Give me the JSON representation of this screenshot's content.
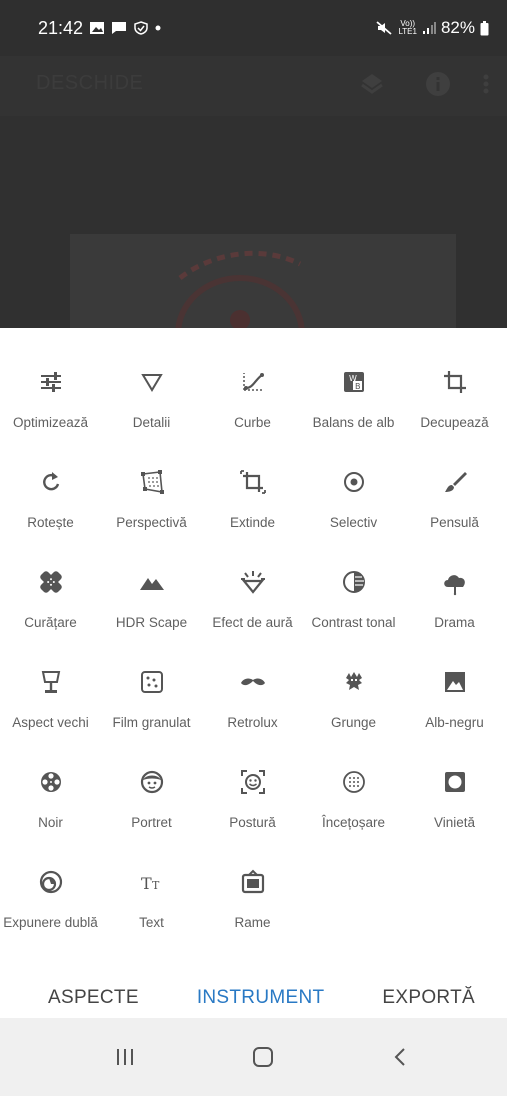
{
  "status_bar": {
    "time": "21:42",
    "battery": "82%",
    "network": "LTE1",
    "volte": "Vo))"
  },
  "app": {
    "title": "DESCHIDE"
  },
  "tools": [
    {
      "label": "Optimizează",
      "icon": "tune-sliders-icon"
    },
    {
      "label": "Detalii",
      "icon": "triangle-down-icon"
    },
    {
      "label": "Curbe",
      "icon": "curves-icon"
    },
    {
      "label": "Balans de alb",
      "icon": "white-balance-icon"
    },
    {
      "label": "Decupează",
      "icon": "crop-icon"
    },
    {
      "label": "Rotește",
      "icon": "rotate-icon"
    },
    {
      "label": "Perspectivă",
      "icon": "perspective-icon"
    },
    {
      "label": "Extinde",
      "icon": "expand-icon"
    },
    {
      "label": "Selectiv",
      "icon": "selective-icon"
    },
    {
      "label": "Pensulă",
      "icon": "brush-icon"
    },
    {
      "label": "Curățare",
      "icon": "healing-icon"
    },
    {
      "label": "HDR Scape",
      "icon": "mountains-icon"
    },
    {
      "label": "Efect de aură",
      "icon": "glamour-glow-icon"
    },
    {
      "label": "Contrast tonal",
      "icon": "tonal-contrast-icon"
    },
    {
      "label": "Drama",
      "icon": "cloud-icon"
    },
    {
      "label": "Aspect vechi",
      "icon": "vintage-lamp-icon"
    },
    {
      "label": "Film granulat",
      "icon": "grainy-film-icon"
    },
    {
      "label": "Retrolux",
      "icon": "mustache-icon"
    },
    {
      "label": "Grunge",
      "icon": "grunge-icon"
    },
    {
      "label": "Alb-negru",
      "icon": "black-white-icon"
    },
    {
      "label": "Noir",
      "icon": "film-reel-icon"
    },
    {
      "label": "Portret",
      "icon": "face-icon"
    },
    {
      "label": "Postură",
      "icon": "face-pose-icon"
    },
    {
      "label": "Încețoșare",
      "icon": "lens-blur-icon"
    },
    {
      "label": "Vinietă",
      "icon": "vignette-icon"
    },
    {
      "label": "Expunere dublă",
      "icon": "double-exposure-icon"
    },
    {
      "label": "Text",
      "icon": "text-icon"
    },
    {
      "label": "Rame",
      "icon": "frame-icon"
    }
  ],
  "tabs": [
    {
      "label": "ASPECTE",
      "active": false
    },
    {
      "label": "INSTRUMENT",
      "active": true
    },
    {
      "label": "EXPORTĂ",
      "active": false
    }
  ],
  "colors": {
    "accent": "#2979c4",
    "icon": "#555555",
    "label": "#606060"
  }
}
